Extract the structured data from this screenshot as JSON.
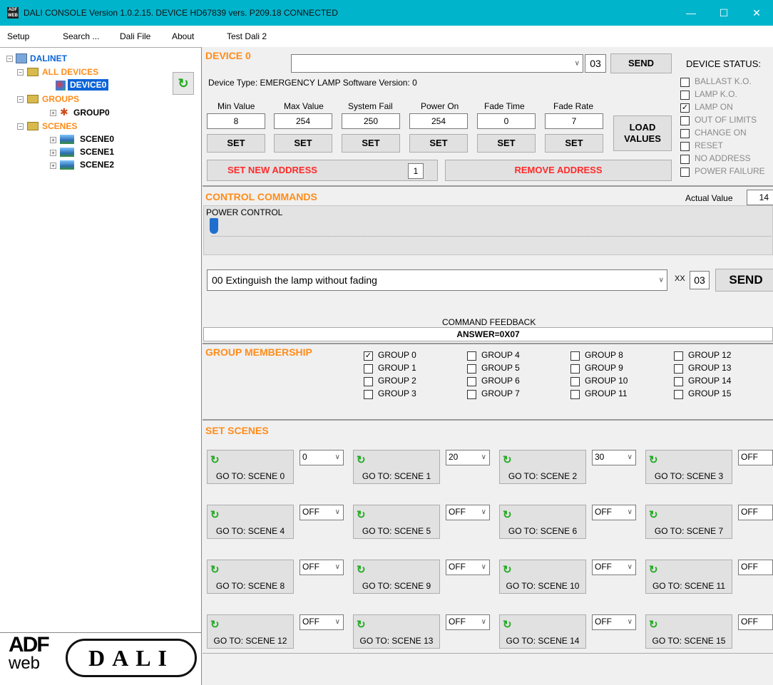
{
  "window": {
    "app_icon_text": "ADF WEB",
    "title": "DALI CONSOLE Version 1.0.2.15.  DEVICE HD67839    vers. P209.18 CONNECTED",
    "minimize": "—",
    "maximize": "☐",
    "close": "✕"
  },
  "menu": [
    "Setup",
    "Search ...",
    "Dali File",
    "About",
    "Test Dali 2"
  ],
  "tree": {
    "root": "DALINET",
    "all_devices": "ALL DEVICES",
    "device0": "DEVICE0",
    "groups": "GROUPS",
    "group0": "GROUP0",
    "scenes": "SCENES",
    "scene0": "SCENE0",
    "scene1": "SCENE1",
    "scene2": "SCENE2"
  },
  "logos": {
    "adf_top": "ADF",
    "adf_bottom": "web",
    "dali": "DALI"
  },
  "device": {
    "title": "DEVICE 0",
    "address_value": "",
    "address_code": "03",
    "send_label": "SEND",
    "info": "Device Type: EMERGENCY LAMP   Software Version: 0",
    "params": [
      {
        "label": "Min Value",
        "value": "8"
      },
      {
        "label": "Max Value",
        "value": "254"
      },
      {
        "label": "System Fail",
        "value": "250"
      },
      {
        "label": "Power On",
        "value": "254"
      },
      {
        "label": "Fade Time",
        "value": "0"
      },
      {
        "label": "Fade Rate",
        "value": "7"
      }
    ],
    "set_label": "SET",
    "load_label_1": "LOAD",
    "load_label_2": "VALUES",
    "set_new_address": "SET NEW ADDRESS",
    "new_address_value": "1",
    "remove_address": "REMOVE  ADDRESS"
  },
  "status": {
    "title": "DEVICE STATUS:",
    "items": [
      {
        "label": "BALLAST K.O.",
        "checked": false
      },
      {
        "label": "LAMP K.O.",
        "checked": false
      },
      {
        "label": "LAMP ON",
        "checked": true
      },
      {
        "label": "OUT OF LIMITS",
        "checked": false
      },
      {
        "label": "CHANGE ON",
        "checked": false
      },
      {
        "label": "RESET",
        "checked": false
      },
      {
        "label": "NO ADDRESS",
        "checked": false
      },
      {
        "label": "POWER FAILURE",
        "checked": false
      }
    ]
  },
  "control": {
    "title": "CONTROL COMMANDS",
    "actual_value_label": "Actual Value",
    "actual_value": "14",
    "power_control_label": "POWER CONTROL",
    "power_level_fraction": 0.0,
    "command_selected": "00 Extinguish the lamp without fading",
    "xx_label": "XX",
    "xx_value": "03",
    "send_label": "SEND",
    "feedback_label": "COMMAND FEEDBACK",
    "feedback_value": "ANSWER=0X07"
  },
  "groups": {
    "title": "GROUP MEMBERSHIP",
    "items": [
      {
        "label": "GROUP 0",
        "checked": true
      },
      {
        "label": "GROUP 1",
        "checked": false
      },
      {
        "label": "GROUP 2",
        "checked": false
      },
      {
        "label": "GROUP 3",
        "checked": false
      },
      {
        "label": "GROUP 4",
        "checked": false
      },
      {
        "label": "GROUP 5",
        "checked": false
      },
      {
        "label": "GROUP 6",
        "checked": false
      },
      {
        "label": "GROUP 7",
        "checked": false
      },
      {
        "label": "GROUP 8",
        "checked": false
      },
      {
        "label": "GROUP 9",
        "checked": false
      },
      {
        "label": "GROUP 10",
        "checked": false
      },
      {
        "label": "GROUP 11",
        "checked": false
      },
      {
        "label": "GROUP 12",
        "checked": false
      },
      {
        "label": "GROUP 13",
        "checked": false
      },
      {
        "label": "GROUP 14",
        "checked": false
      },
      {
        "label": "GROUP 15",
        "checked": false
      }
    ]
  },
  "scenes": {
    "title": "SET SCENES",
    "items": [
      {
        "label": "GO TO: SCENE 0",
        "value": "0"
      },
      {
        "label": "GO TO: SCENE 1",
        "value": "20"
      },
      {
        "label": "GO TO: SCENE 2",
        "value": "30"
      },
      {
        "label": "GO TO: SCENE 3",
        "value": "OFF"
      },
      {
        "label": "GO TO: SCENE 4",
        "value": "OFF"
      },
      {
        "label": "GO TO: SCENE 5",
        "value": "OFF"
      },
      {
        "label": "GO TO: SCENE 6",
        "value": "OFF"
      },
      {
        "label": "GO TO: SCENE 7",
        "value": "OFF"
      },
      {
        "label": "GO TO: SCENE 8",
        "value": "OFF"
      },
      {
        "label": "GO TO: SCENE 9",
        "value": "OFF"
      },
      {
        "label": "GO TO: SCENE 10",
        "value": "OFF"
      },
      {
        "label": "GO TO: SCENE 11",
        "value": "OFF"
      },
      {
        "label": "GO TO: SCENE 12",
        "value": "OFF"
      },
      {
        "label": "GO TO: SCENE 13",
        "value": "OFF"
      },
      {
        "label": "GO TO: SCENE 14",
        "value": "OFF"
      },
      {
        "label": "GO TO: SCENE 15",
        "value": "OFF"
      }
    ]
  },
  "colors": {
    "accent_orange": "#ff8c1a",
    "titlebar": "#00b4cc",
    "red_text": "#ff2a2a",
    "tree_blue": "#0a64d8"
  }
}
